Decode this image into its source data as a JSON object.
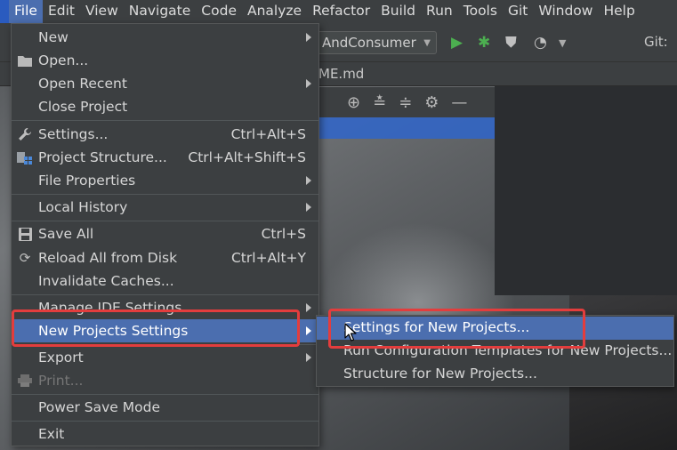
{
  "menubar": {
    "items": [
      {
        "label": "File",
        "active": true
      },
      {
        "label": "Edit"
      },
      {
        "label": "View"
      },
      {
        "label": "Navigate"
      },
      {
        "label": "Code"
      },
      {
        "label": "Analyze"
      },
      {
        "label": "Refactor"
      },
      {
        "label": "Build"
      },
      {
        "label": "Run"
      },
      {
        "label": "Tools"
      },
      {
        "label": "Git"
      },
      {
        "label": "Window"
      },
      {
        "label": "Help"
      }
    ]
  },
  "toolbar": {
    "run_config_label": "AndConsumer",
    "git_label": "Git:"
  },
  "editor_tab": {
    "label": "ME.md"
  },
  "file_menu": {
    "items": [
      {
        "label": "New",
        "submenu": true
      },
      {
        "label": "Open...",
        "icon": "folder-icon"
      },
      {
        "label": "Open Recent",
        "submenu": true
      },
      {
        "label": "Close Project"
      },
      {
        "label": "Settings...",
        "shortcut": "Ctrl+Alt+S",
        "icon": "wrench-icon"
      },
      {
        "label": "Project Structure...",
        "shortcut": "Ctrl+Alt+Shift+S",
        "icon": "project-structure-icon"
      },
      {
        "label": "File Properties",
        "submenu": true
      },
      {
        "label": "Local History",
        "submenu": true
      },
      {
        "label": "Save All",
        "shortcut": "Ctrl+S",
        "icon": "save-icon"
      },
      {
        "label": "Reload All from Disk",
        "shortcut": "Ctrl+Alt+Y",
        "icon": "reload-icon"
      },
      {
        "label": "Invalidate Caches..."
      },
      {
        "label": "Manage IDE Settings",
        "submenu": true
      },
      {
        "label": "New Projects Settings",
        "submenu": true,
        "highlighted": true
      },
      {
        "label": "Export",
        "submenu": true
      },
      {
        "label": "Print...",
        "disabled": true,
        "icon": "print-icon"
      },
      {
        "label": "Power Save Mode"
      },
      {
        "label": "Exit"
      }
    ]
  },
  "submenu": {
    "items": [
      {
        "label": "Settings for New Projects...",
        "highlighted": true
      },
      {
        "label": "Run Configuration Templates for New Projects..."
      },
      {
        "label": "Structure for New Projects..."
      }
    ]
  },
  "colors": {
    "menu_bg": "#3c3f41",
    "highlight": "#4b6eaf",
    "annotation_red": "#e33d3d"
  }
}
